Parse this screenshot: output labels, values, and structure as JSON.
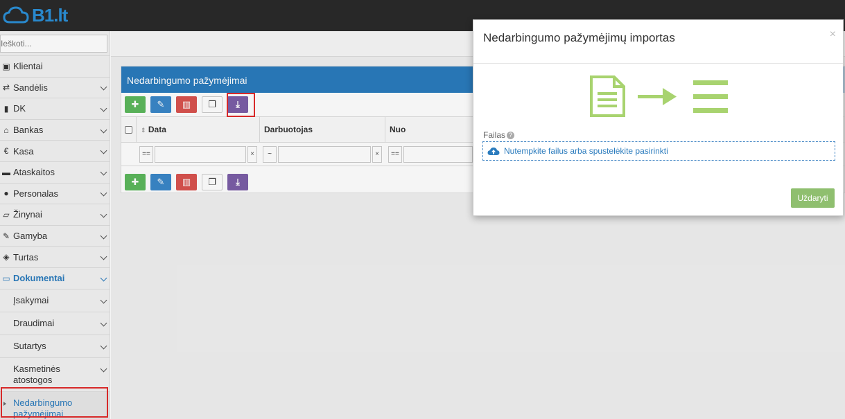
{
  "header": {
    "logo_text": "B1.lt"
  },
  "sidebar": {
    "search_placeholder": "Ieškoti...",
    "items": [
      {
        "label": "Klientai",
        "icon": "address-book-icon"
      },
      {
        "label": "Sandėlis",
        "icon": "exchange-icon"
      },
      {
        "label": "DK",
        "icon": "book-icon"
      },
      {
        "label": "Bankas",
        "icon": "bank-icon"
      },
      {
        "label": "Kasa",
        "icon": "euro-icon"
      },
      {
        "label": "Ataskaitos",
        "icon": "folder-icon"
      },
      {
        "label": "Personalas",
        "icon": "users-icon"
      },
      {
        "label": "Žinynai",
        "icon": "folder-open-icon"
      },
      {
        "label": "Gamyba",
        "icon": "wrench-icon"
      },
      {
        "label": "Turtas",
        "icon": "cube-icon"
      },
      {
        "label": "Dokumentai",
        "icon": "inbox-icon"
      }
    ],
    "sub_items": [
      {
        "label": "Įsakymai"
      },
      {
        "label": "Draudimai"
      },
      {
        "label": "Sutartys"
      },
      {
        "label": "Kasmetinės atostogos"
      },
      {
        "label": "Nedarbingumo pažymėjimai"
      }
    ]
  },
  "panel": {
    "title": "Nedarbingumo pažymėjimai",
    "columns": [
      "Data",
      "Darbuotojas",
      "Nuo"
    ],
    "filters": [
      "==",
      "~",
      "=="
    ],
    "clear": "×"
  },
  "modal": {
    "title": "Nedarbingumo pažymėjimų importas",
    "close_symbol": "×",
    "file_label": "Failas",
    "help_symbol": "?",
    "dropzone_text": "Nutempkite failus arba spustelėkite pasirinkti",
    "close_button": "Uždaryti"
  },
  "colors": {
    "accent": "#2a7bbd",
    "success": "#8fbf6f",
    "graphic": "#a8d36f"
  }
}
